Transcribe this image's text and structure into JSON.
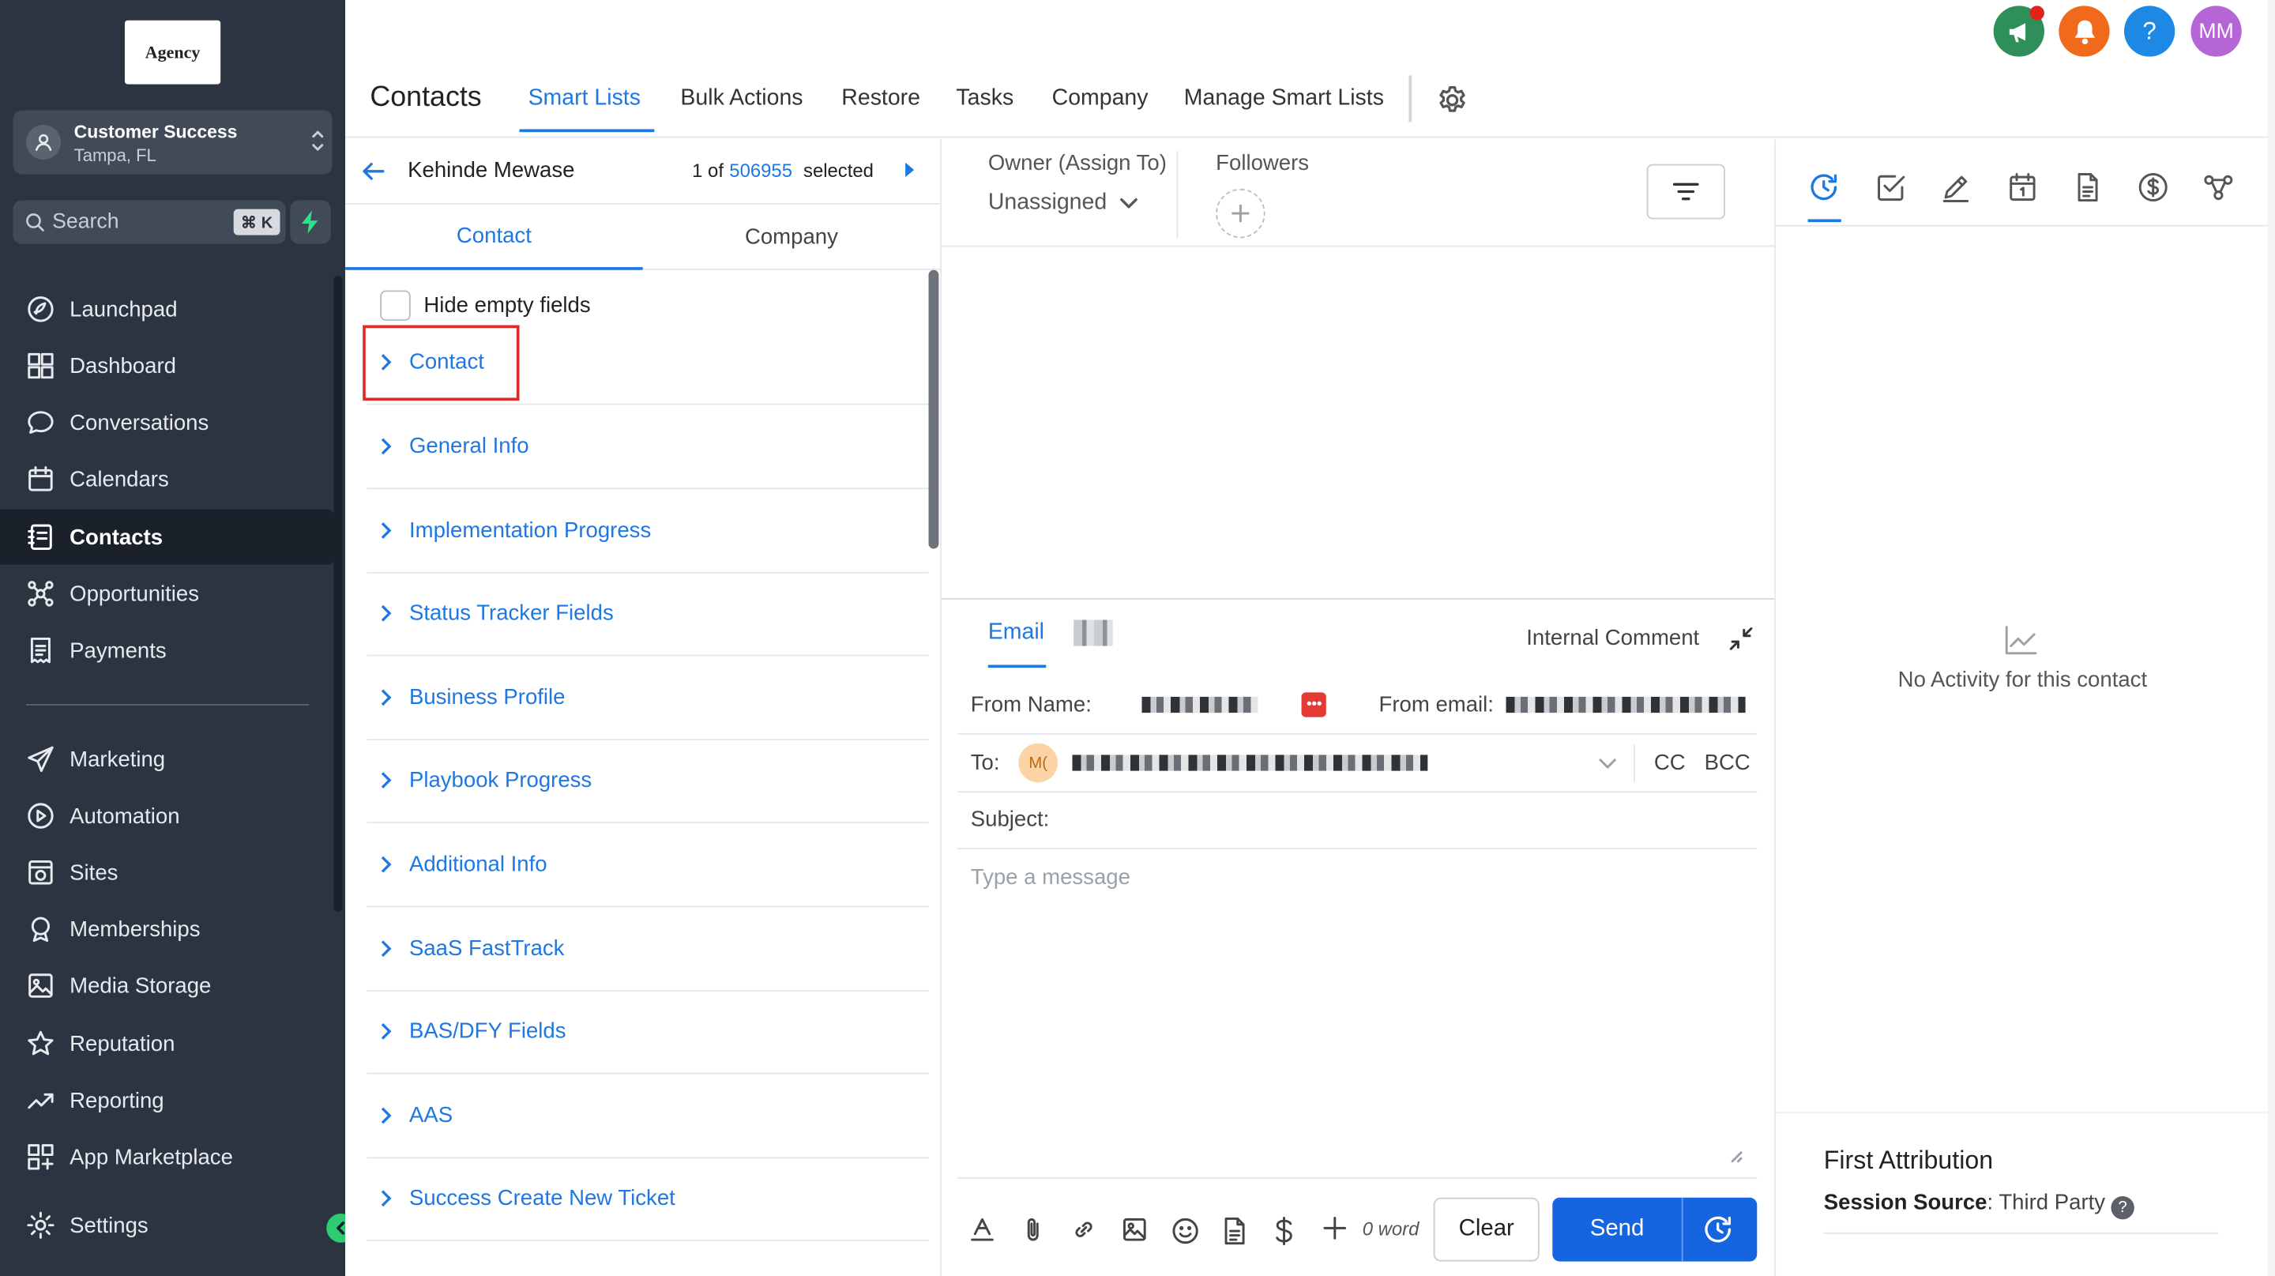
{
  "sidebar": {
    "logo_text": "Agency",
    "location": {
      "name": "Customer Success",
      "city": "Tampa, FL"
    },
    "search": {
      "placeholder": "Search",
      "shortcut": "⌘ K"
    },
    "items": [
      {
        "label": "Launchpad",
        "icon": "rocket-icon"
      },
      {
        "label": "Dashboard",
        "icon": "grid-icon"
      },
      {
        "label": "Conversations",
        "icon": "chat-icon"
      },
      {
        "label": "Calendars",
        "icon": "calendar-icon"
      },
      {
        "label": "Contacts",
        "icon": "contacts-icon",
        "active": true
      },
      {
        "label": "Opportunities",
        "icon": "opportunities-icon"
      },
      {
        "label": "Payments",
        "icon": "payments-icon"
      }
    ],
    "items2": [
      {
        "label": "Marketing",
        "icon": "send-icon"
      },
      {
        "label": "Automation",
        "icon": "automation-icon"
      },
      {
        "label": "Sites",
        "icon": "globe-icon"
      },
      {
        "label": "Memberships",
        "icon": "membership-icon"
      },
      {
        "label": "Media Storage",
        "icon": "image-icon"
      },
      {
        "label": "Reputation",
        "icon": "star-icon"
      },
      {
        "label": "Reporting",
        "icon": "trend-icon"
      },
      {
        "label": "App Marketplace",
        "icon": "apps-icon"
      }
    ],
    "settings_label": "Settings"
  },
  "header": {
    "title": "Contacts",
    "tabs": [
      "Smart Lists",
      "Bulk Actions",
      "Restore",
      "Tasks",
      "Company",
      "Manage Smart Lists"
    ],
    "avatar_initials": "MM",
    "help_label": "?"
  },
  "contact": {
    "name": "Kehinde Mewase",
    "position_prefix": "1 of",
    "total": "506955",
    "selected_label": "selected",
    "tabs": [
      "Contact",
      "Company"
    ],
    "hide_empty_label": "Hide empty fields",
    "sections": [
      "Contact",
      "General Info",
      "Implementation Progress",
      "Status Tracker Fields",
      "Business Profile",
      "Playbook Progress",
      "Additional Info",
      "SaaS FastTrack",
      "BAS/DFY Fields",
      "AAS",
      "Success Create New Ticket"
    ]
  },
  "assignment": {
    "owner_label": "Owner (Assign To)",
    "owner_value": "Unassigned",
    "followers_label": "Followers"
  },
  "composer": {
    "tab_email": "Email",
    "internal_comment": "Internal Comment",
    "from_name_label": "From Name:",
    "from_email_label": "From email:",
    "to_label": "To:",
    "to_avatar": "M(",
    "cc": "CC",
    "bcc": "BCC",
    "subject_label": "Subject:",
    "message_placeholder": "Type a message",
    "word_count": "0 word",
    "clear": "Clear",
    "send": "Send"
  },
  "activity": {
    "empty_text": "No Activity for this contact",
    "first_attribution": "First Attribution",
    "session_source_label": "Session Source",
    "session_source_value": "Third Party"
  },
  "colors": {
    "accent": "#1e77e3",
    "sidebar": "#2b3440",
    "highlight": "#e02b2b",
    "send": "#1565e0"
  }
}
